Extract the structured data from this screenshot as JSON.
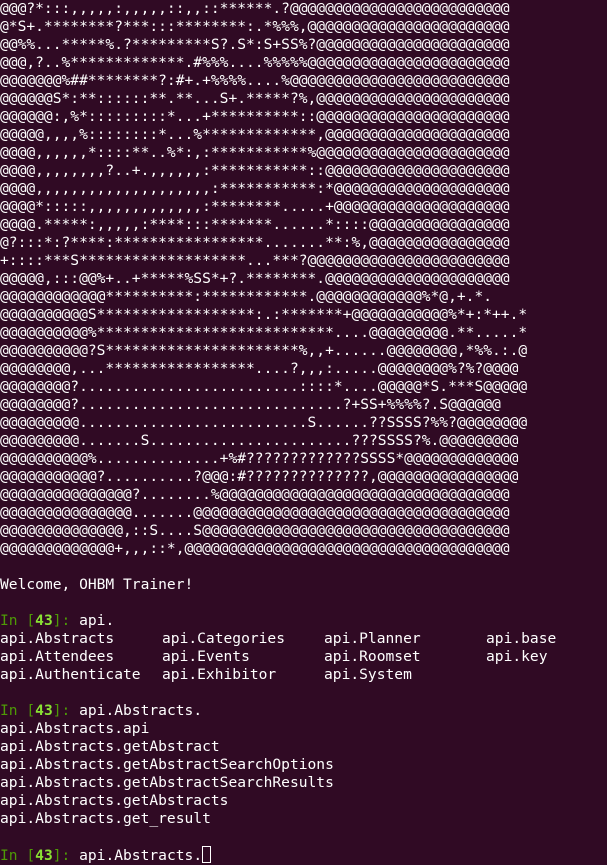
{
  "terminal": {
    "background": "#300a24",
    "prompt_color": "#4e9a06",
    "prompt_number_color": "#8ae234"
  },
  "ascii_art": [
    "@@@?*:::,,,,,:,,,,,::,,::******.?@@@@@@@@@@@@@@@@@@@@@@@@@",
    "@*S+.********?***:::********:.*%%%,@@@@@@@@@@@@@@@@@@@@@@@",
    "@@%%...*****%.?*********S?.S*:S+SS%?@@@@@@@@@@@@@@@@@@@@@@",
    "@@@,?..%*************.#%%%....%%%%%@@@@@@@@@@@@@@@@@@@@@@@",
    "@@@@@@@%##********?:#+.+%%%%....%@@@@@@@@@@@@@@@@@@@@@@@@@",
    "@@@@@@S*:**::::::**.**...S+.*****?%,@@@@@@@@@@@@@@@@@@@@@@",
    "@@@@@@:,%*:::::::::*...+**********::@@@@@@@@@@@@@@@@@@@@@@",
    "@@@@@,,,,%::::::::*...%*************,@@@@@@@@@@@@@@@@@@@@@",
    "@@@@,,,,,,*::::**..%*:,:***********%@@@@@@@@@@@@@@@@@@@@@@",
    "@@@@,,,,,,,,?..+.,,,,,,:***********::@@@@@@@@@@@@@@@@@@@@@",
    "@@@@,,,,,,,,,,,,,,,,,,,,:***********:*@@@@@@@@@@@@@@@@@@@@",
    "@@@@*:::::,,,,,,,,,,,,,:********.....+@@@@@@@@@@@@@@@@@@@@",
    "@@@@.*****:,,,,,:****:::*******......*::::@@@@@@@@@@@@@@@@",
    "@?:::*:?****:*****************.......**:%,@@@@@@@@@@@@@@@@",
    "+::::***S*******************...***?@@@@@@@@@@@@@@@@@@@@@@@",
    "@@@@@,:::@@%+..+*****%SS*+?.********.@@@@@@@@@@@@@@@@@@@@@",
    "@@@@@@@@@@@@**********:************.@@@@@@@@@@@@%*@,+.*.",
    "@@@@@@@@@@S******************:.:*******+@@@@@@@@@@@%*+:*++.*",
    "@@@@@@@@@@%***************************....@@@@@@@@@.**.....*",
    "@@@@@@@@@@?S**********************%,,+......@@@@@@@@,*%%.:.@",
    "@@@@@@@@,...*****************....?,,,:.....@@@@@@@@%?%?@@@@",
    "@@@@@@@@?.........................::::*....@@@@@*S.***S@@@@@",
    "@@@@@@@@?..............................?+SS+%%%%?.S@@@@@@",
    "@@@@@@@@@..........................S......??SSSS?%%?@@@@@@@@",
    "@@@@@@@@@.......S.......................???SSSS?%.@@@@@@@@@",
    "@@@@@@@@@@%..............+%#?????????????SSSS*@@@@@@@@@@@@@",
    "@@@@@@@@@@@?..........?@@@:#??????????????,@@@@@@@@@@@@@@@@",
    "@@@@@@@@@@@@@@@?........%@@@@@@@@@@@@@@@@@@@@@@@@@@@@@@@@@",
    "@@@@@@@@@@@@@@@.......@@@@@@@@@@@@@@@@@@@@@@@@@@@@@@@@@@@@",
    "@@@@@@@@@@@@@@,::S....S@@@@@@@@@@@@@@@@@@@@@@@@@@@@@@@@@@@",
    "@@@@@@@@@@@@@+,,,::*,@@@@@@@@@@@@@@@@@@@@@@@@@@@@@@@@@@@@@"
  ],
  "welcome": "Welcome, OHBM Trainer!",
  "prompt": {
    "in_label": "In [",
    "number": "43",
    "close": "]: "
  },
  "input1": "api.",
  "completions1": [
    "api.Abstracts",
    "api.Categories",
    "api.Planner",
    "api.base",
    "api.Attendees",
    "api.Events",
    "api.Roomset",
    "api.key",
    "api.Authenticate",
    "api.Exhibitor",
    "api.System",
    ""
  ],
  "input2": "api.Abstracts.",
  "completions2": [
    "api.Abstracts.api",
    "api.Abstracts.getAbstract",
    "api.Abstracts.getAbstractSearchOptions",
    "api.Abstracts.getAbstractSearchResults",
    "api.Abstracts.getAbstracts",
    "api.Abstracts.get_result"
  ],
  "input3": "api.Abstracts."
}
